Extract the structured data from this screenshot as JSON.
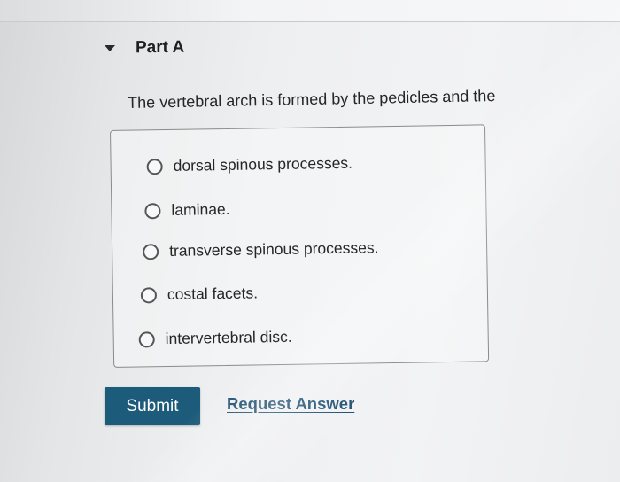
{
  "part": {
    "title": "Part A",
    "chevron_icon": "chevron-down-icon"
  },
  "question": {
    "text": "The vertebral arch is formed by the pedicles and the",
    "options": [
      {
        "label": "dorsal spinous processes.",
        "selected": false
      },
      {
        "label": "laminae.",
        "selected": false
      },
      {
        "label": "transverse spinous processes.",
        "selected": false
      },
      {
        "label": "costal facets.",
        "selected": false
      },
      {
        "label": "intervertebral disc.",
        "selected": false
      }
    ]
  },
  "actions": {
    "submit_label": "Submit",
    "request_answer_label": "Request Answer"
  },
  "colors": {
    "submit_bg": "#1c5b7a",
    "link": "#1d4f70"
  }
}
